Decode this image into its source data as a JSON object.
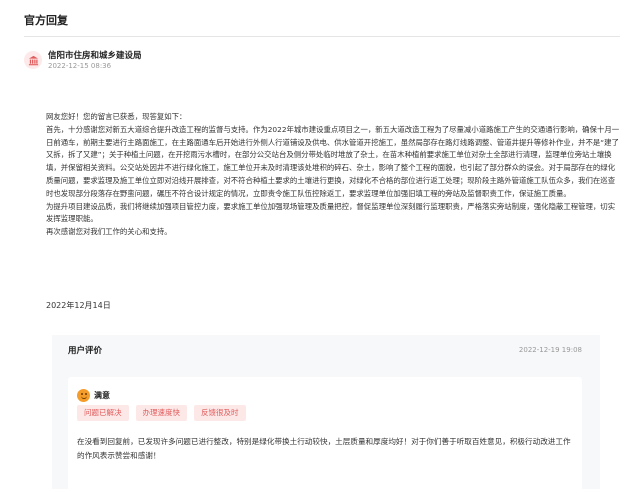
{
  "header": {
    "title": "官方回复"
  },
  "reply": {
    "org_name": "信阳市住房和城乡建设局",
    "timestamp": "2022-12-15 08:36",
    "paragraphs": [
      "网友您好！您的留言已获悉，现答复如下：",
      "首先，十分感谢您对新五大道综合提升改造工程的监督与支持。作为2022年城市建设重点项目之一，新五大道改造工程为了尽量减小道路施工产生的交通通行影响，确保十月一日前通车，前期主要进行主路面施工，在主路面通车后开始进行外侧人行道铺设及供电、供水管道开挖施工，虽然局部存在路灯线路调整、管道井提升等修补作业，并不是“建了又拆，拆了又建”；关于种植土问题，在开挖雨污水槽时，在部分公交站台及侧分带处临时堆放了杂土，在苗木种植前要求施工单位对杂土全部进行清理，监理单位旁站土壤换填，并保留相关资料。公交站处因井不进行绿化施工，施工单位开未及时清理该处堆积的碎石、杂土，影响了整个工程的面貌，也引起了部分群众的误会。对于局部存在的绿化质量问题，要求监理及施工单位立即对沿线开展排查，对不符合种植土要求的土壤进行更换，对绿化不合格的部位进行返工处理；现阶段主路外管道施工队伍众多，我们在巡查时也发现部分段落存在野蛮问题，碾压不符合设计规定的情况，立即责令施工队伍控除返工，要求监理单位加强旧填工程的旁站及监督职责工作，保证施工质量。",
      "为提升项目建设品质，我们将继续加强项目管控力度，要求施工单位加强现场管理及质量把控，督促监理单位深刻履行监理职责，严格落实旁站制度，强化隐蔽工程管理，切实发挥监理职能。",
      "再次感谢您对我们工作的关心和支持。"
    ],
    "date": "2022年12月14日"
  },
  "evaluation": {
    "title": "用户评价",
    "timestamp": "2022-12-19 19:08",
    "rating_label": "满意",
    "emoji_icon": "smile-face-icon",
    "tags": [
      "问题已解决",
      "办理速度快",
      "反馈很及时"
    ],
    "comment": "在没看到回复前，已发现许多问题已进行整改，特别是绿化带换土行动较快，土层质量和厚度均好！对于你们善于听取百姓意见，积极行动改进工作的作风表示赞尝和感谢！"
  },
  "colors": {
    "tag_bg": "#fde8e8",
    "tag_text": "#e15a5a",
    "panel_bg": "#f7f8fa",
    "avatar_bg": "#fde9e9",
    "accent": "#e15a5a"
  }
}
